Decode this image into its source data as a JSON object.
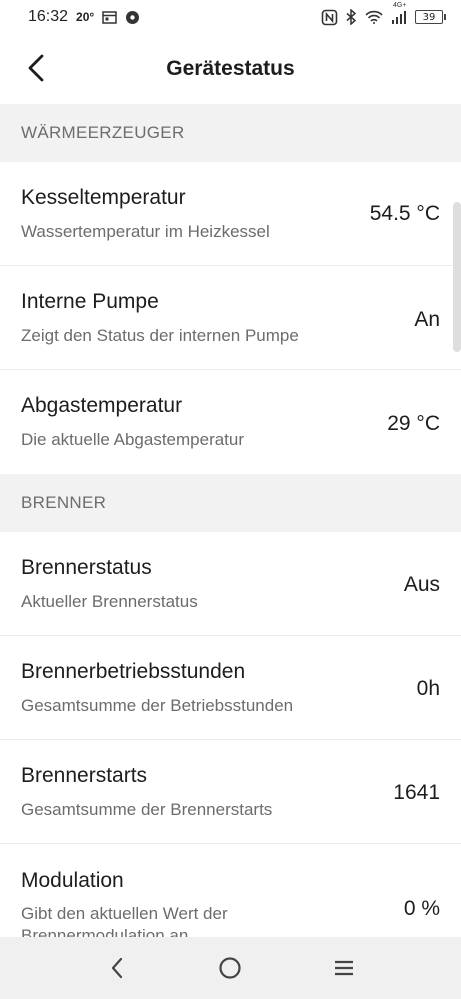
{
  "status_bar": {
    "time": "16:32",
    "temp": "20°",
    "battery": "39",
    "network": "4G+"
  },
  "header": {
    "title": "Gerätestatus"
  },
  "sections": [
    {
      "title": "WÄRMEERZEUGER",
      "rows": [
        {
          "title": "Kesseltemperatur",
          "subtitle": "Wassertemperatur im Heizkessel",
          "value": "54.5 °C"
        },
        {
          "title": "Interne Pumpe",
          "subtitle": "Zeigt den Status der internen Pumpe",
          "value": "An"
        },
        {
          "title": "Abgastemperatur",
          "subtitle": "Die aktuelle Abgastemperatur",
          "value": "29 °C"
        }
      ]
    },
    {
      "title": "BRENNER",
      "rows": [
        {
          "title": "Brennerstatus",
          "subtitle": "Aktueller Brennerstatus",
          "value": "Aus"
        },
        {
          "title": "Brennerbetriebsstunden",
          "subtitle": "Gesamtsumme der Betriebsstunden",
          "value": "0h"
        },
        {
          "title": "Brennerstarts",
          "subtitle": "Gesamtsumme der Brennerstarts",
          "value": "1641"
        },
        {
          "title": "Modulation",
          "subtitle": "Gibt den aktuellen Wert der Brennermodulation an",
          "value": "0 %"
        }
      ]
    }
  ]
}
